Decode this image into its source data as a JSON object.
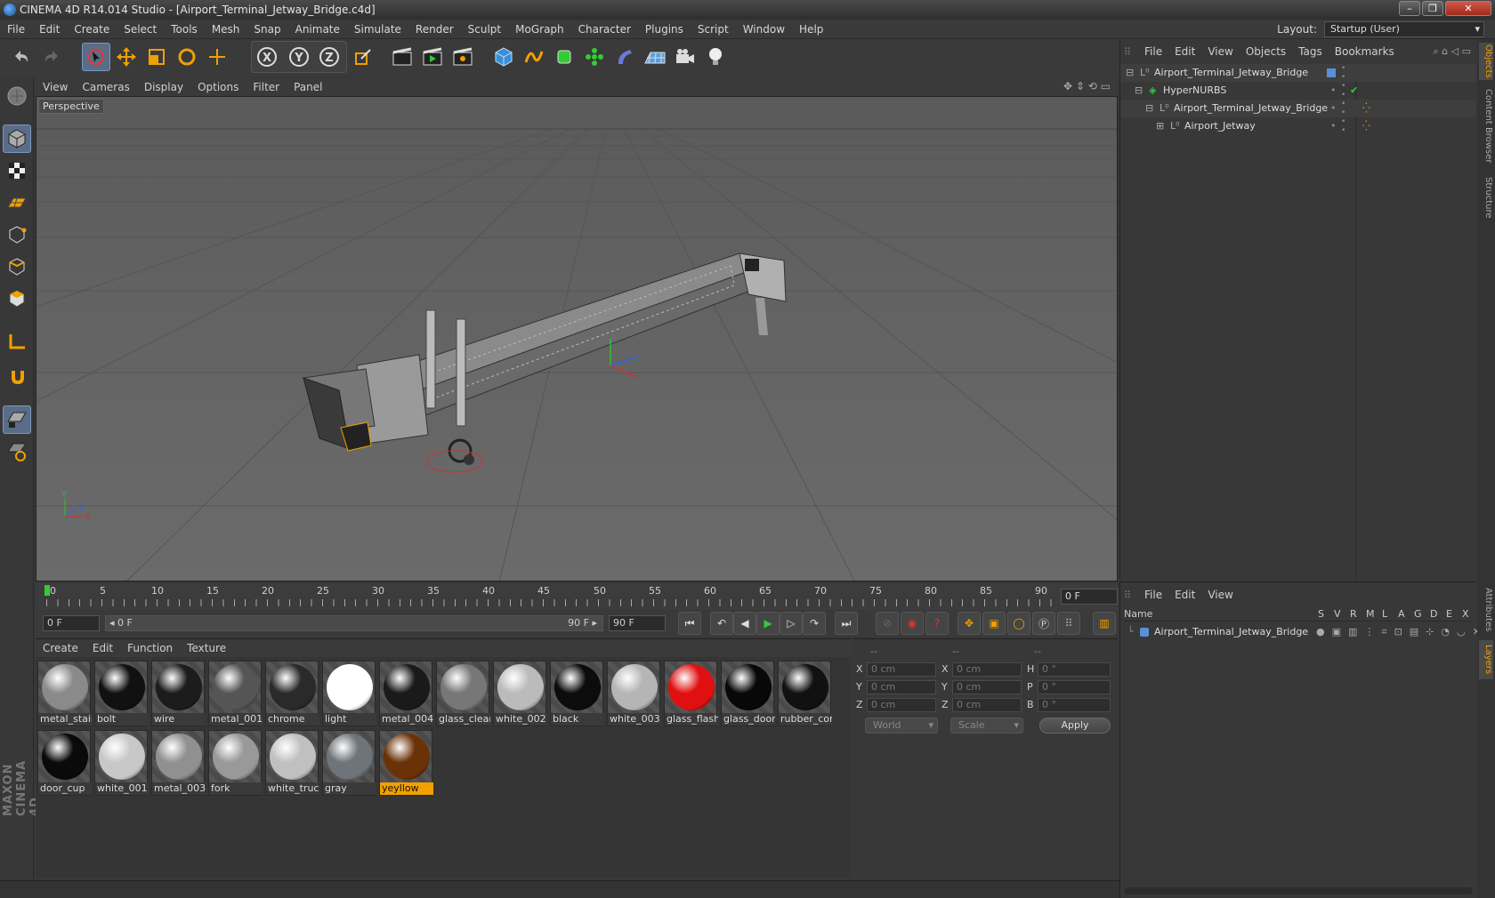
{
  "title": "CINEMA 4D R14.014 Studio - [Airport_Terminal_Jetway_Bridge.c4d]",
  "window_buttons": {
    "minimize": "–",
    "maximize": "❐",
    "close": "✕"
  },
  "menu": [
    "File",
    "Edit",
    "Create",
    "Select",
    "Tools",
    "Mesh",
    "Snap",
    "Animate",
    "Simulate",
    "Render",
    "Sculpt",
    "MoGraph",
    "Character",
    "Plugins",
    "Script",
    "Window",
    "Help"
  ],
  "layout": {
    "label": "Layout:",
    "value": "Startup (User)"
  },
  "viewport": {
    "menu": [
      "View",
      "Cameras",
      "Display",
      "Options",
      "Filter",
      "Panel"
    ],
    "label": "Perspective"
  },
  "timeline": {
    "ticks": [
      "0",
      "5",
      "10",
      "15",
      "20",
      "25",
      "30",
      "35",
      "40",
      "45",
      "50",
      "55",
      "60",
      "65",
      "70",
      "75",
      "80",
      "85",
      "90"
    ],
    "current_frame": "0 F"
  },
  "transport": {
    "start_field": "0 F",
    "range_start": "◂ 0 F",
    "range_end": "90 F ▸",
    "end_field": "90 F"
  },
  "materials": {
    "menu": [
      "Create",
      "Edit",
      "Function",
      "Texture"
    ],
    "items": [
      {
        "name": "metal_stair",
        "color": "#8a8a8a"
      },
      {
        "name": "bolt",
        "color": "#111111"
      },
      {
        "name": "wire",
        "color": "#1c1c1c"
      },
      {
        "name": "metal_001",
        "color": "#555555"
      },
      {
        "name": "chrome",
        "color": "#2a2a2a"
      },
      {
        "name": "light",
        "color": "#ffffff"
      },
      {
        "name": "metal_004",
        "color": "#1a1a1a"
      },
      {
        "name": "glass_clear",
        "color": "#777777"
      },
      {
        "name": "white_002",
        "color": "#bbbbbb"
      },
      {
        "name": "black",
        "color": "#0c0c0c"
      },
      {
        "name": "white_003",
        "color": "#b5b5b5"
      },
      {
        "name": "glass_flash",
        "color": "#e01010"
      },
      {
        "name": "glass_door",
        "color": "#080808"
      },
      {
        "name": "rubber_cor",
        "color": "#111111"
      },
      {
        "name": "door_cup",
        "color": "#0a0a0a"
      },
      {
        "name": "white_001",
        "color": "#c8c8c8"
      },
      {
        "name": "metal_003",
        "color": "#909090"
      },
      {
        "name": "fork",
        "color": "#999999"
      },
      {
        "name": "white_truck",
        "color": "#c0c0c0"
      },
      {
        "name": "gray",
        "color": "#6e747a"
      },
      {
        "name": "yeyllow",
        "color": "#6b3208"
      }
    ]
  },
  "coords": {
    "headers": [
      "--",
      "--",
      "--"
    ],
    "rows": [
      {
        "a": "X",
        "av": "0 cm",
        "b": "X",
        "bv": "0 cm",
        "c": "H",
        "cv": "0 °"
      },
      {
        "a": "Y",
        "av": "0 cm",
        "b": "Y",
        "bv": "0 cm",
        "c": "P",
        "cv": "0 °"
      },
      {
        "a": "Z",
        "av": "0 cm",
        "b": "Z",
        "bv": "0 cm",
        "c": "B",
        "cv": "0 °"
      }
    ],
    "space": "World",
    "mode": "Scale",
    "apply": "Apply"
  },
  "objects": {
    "menu": [
      "File",
      "Edit",
      "View",
      "Objects",
      "Tags",
      "Bookmarks"
    ],
    "items": [
      {
        "name": "Airport_Terminal_Jetway_Bridge"
      },
      {
        "name": "HyperNURBS"
      },
      {
        "name": "Airport_Terminal_Jetway_Bridge"
      },
      {
        "name": "Airport_Jetway"
      }
    ]
  },
  "layers": {
    "menu": [
      "File",
      "Edit",
      "View"
    ],
    "header_name": "Name",
    "header_cols": [
      "S",
      "V",
      "R",
      "M",
      "L",
      "A",
      "G",
      "D",
      "E",
      "X"
    ],
    "items": [
      {
        "name": "Airport_Terminal_Jetway_Bridge",
        "color": "#5b8fd6"
      }
    ]
  },
  "side_tabs": [
    "Objects",
    "Content Browser",
    "Structure",
    "Attributes",
    "Layers"
  ],
  "brand": "MAXON CINEMA 4D",
  "colors": {
    "accent": "#f0a000",
    "selection": "#5a6d88",
    "axis_x": "#d03030",
    "axis_y": "#30c030",
    "axis_z": "#3060e0"
  }
}
